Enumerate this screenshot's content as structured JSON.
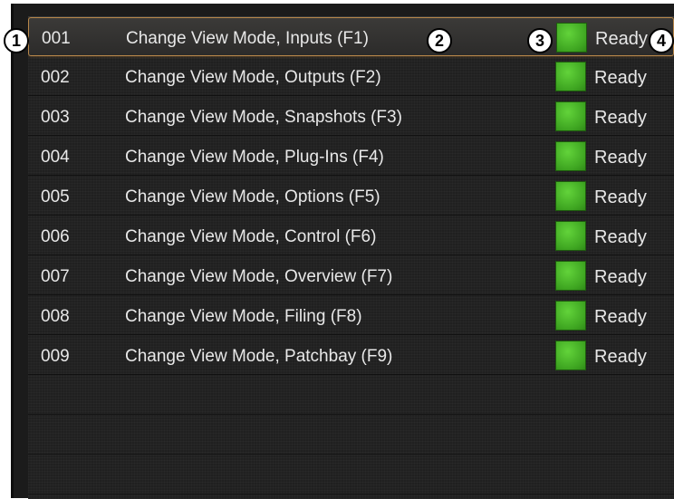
{
  "rows": [
    {
      "number": "001",
      "label": "Change View Mode, Inputs (F1)",
      "status": "Ready"
    },
    {
      "number": "002",
      "label": "Change View Mode, Outputs (F2)",
      "status": "Ready"
    },
    {
      "number": "003",
      "label": "Change View Mode, Snapshots (F3)",
      "status": "Ready"
    },
    {
      "number": "004",
      "label": "Change View Mode, Plug-Ins (F4)",
      "status": "Ready"
    },
    {
      "number": "005",
      "label": "Change View Mode, Options (F5)",
      "status": "Ready"
    },
    {
      "number": "006",
      "label": "Change View Mode, Control (F6)",
      "status": "Ready"
    },
    {
      "number": "007",
      "label": "Change View Mode, Overview (F7)",
      "status": "Ready"
    },
    {
      "number": "008",
      "label": "Change View Mode, Filing (F8)",
      "status": "Ready"
    },
    {
      "number": "009",
      "label": "Change View Mode, Patchbay (F9)",
      "status": "Ready"
    }
  ],
  "selected_row": "001",
  "status_color": "#3ea521",
  "selection_color": "#b8874a",
  "callouts": [
    "1",
    "2",
    "3",
    "4"
  ]
}
